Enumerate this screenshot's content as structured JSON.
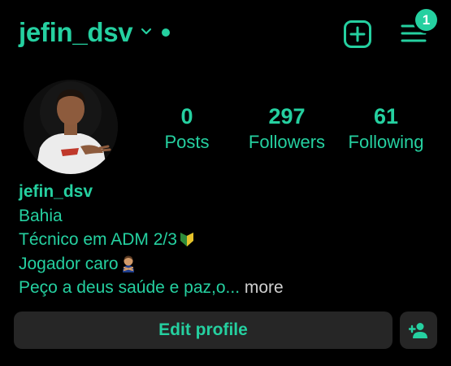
{
  "header": {
    "username": "jefin_dsv",
    "menu_badge_count": "1",
    "online": true
  },
  "profile": {
    "stats": [
      {
        "value": "0",
        "label": "Posts"
      },
      {
        "value": "297",
        "label": "Followers"
      },
      {
        "value": "61",
        "label": "Following"
      }
    ],
    "bio": {
      "name": "jefin_dsv",
      "location": "Bahia",
      "line1": "Técnico em ADM 2/3",
      "line2": "Jogador caro",
      "line3": "Peço a deus saúde e paz,o...",
      "more_label": "more"
    }
  },
  "actions": {
    "edit_profile_label": "Edit profile"
  },
  "colors": {
    "accent": "#25d0a0",
    "background": "#000000",
    "button_bg": "#262626",
    "more_text": "#cfcfcf"
  },
  "icons": [
    "chevron-down-icon",
    "online-dot-icon",
    "new-post-icon",
    "hamburger-menu-icon",
    "add-person-icon"
  ]
}
